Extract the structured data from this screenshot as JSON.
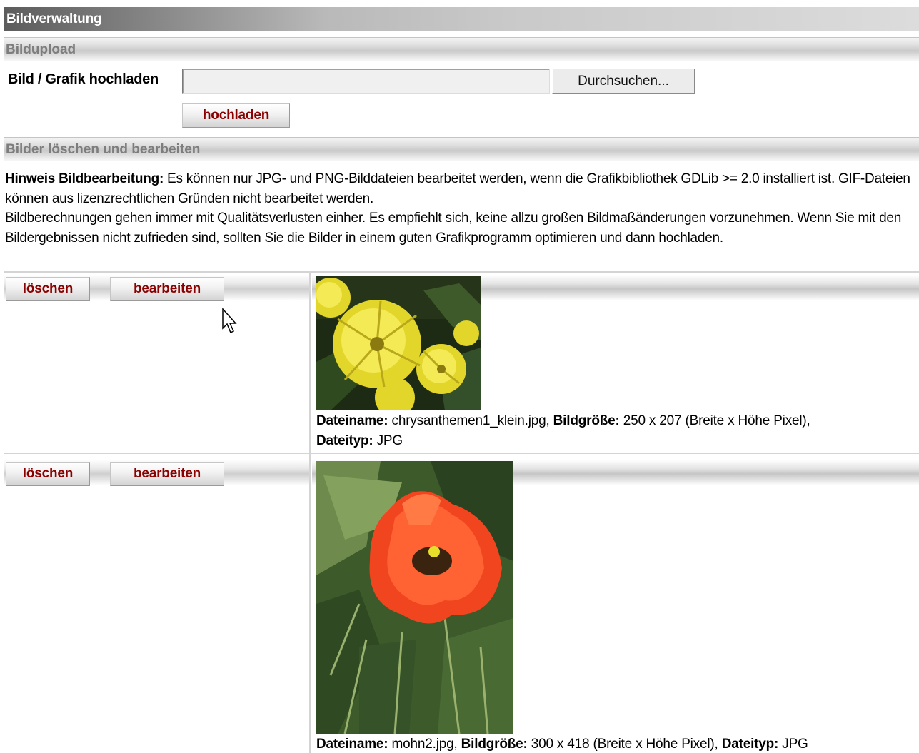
{
  "window": {
    "title": "Bildverwaltung"
  },
  "upload": {
    "section_title": "Bildupload",
    "label": "Bild / Grafik hochladen",
    "file_value": "",
    "browse_label": "Durchsuchen...",
    "upload_label": "hochladen"
  },
  "manage": {
    "section_title": "Bilder löschen und bearbeiten",
    "hint_bold": "Hinweis Bildbearbeitung:",
    "hint_text1": " Es können nur JPG- und PNG-Bilddateien bearbeitet werden, wenn die Grafikbibliothek GDLib >= 2.0 installiert ist. GIF-Dateien können aus lizenzrechtlichen Gründen nicht bearbeitet werden.",
    "hint_text2": "Bildberechnungen gehen immer mit Qualitätsverlusten einher. Es empfiehlt sich, keine allzu großen Bildmaßänderungen vorzunehmen. Wenn Sie mit den Bildergebnissen nicht zufrieden sind, sollten Sie die Bilder in einem guten Grafikprogramm optimieren und dann hochladen."
  },
  "labels": {
    "delete": "löschen",
    "edit": "bearbeiten",
    "filename": "Dateiname:",
    "size": "Bildgröße:",
    "type": "Dateityp:"
  },
  "images": [
    {
      "filename": "chrysanthemen1_klein.jpg",
      "size": "250 x 207 (Breite x Höhe Pixel)",
      "type": "JPG",
      "icon": "yellow-chrysanthemum-photo"
    },
    {
      "filename": "mohn2.jpg",
      "size": "300 x 418 (Breite x Höhe Pixel)",
      "type": "JPG",
      "icon": "red-poppy-photo"
    }
  ],
  "colors": {
    "button_text": "#8b0000",
    "section_text": "#7d7d7d"
  }
}
